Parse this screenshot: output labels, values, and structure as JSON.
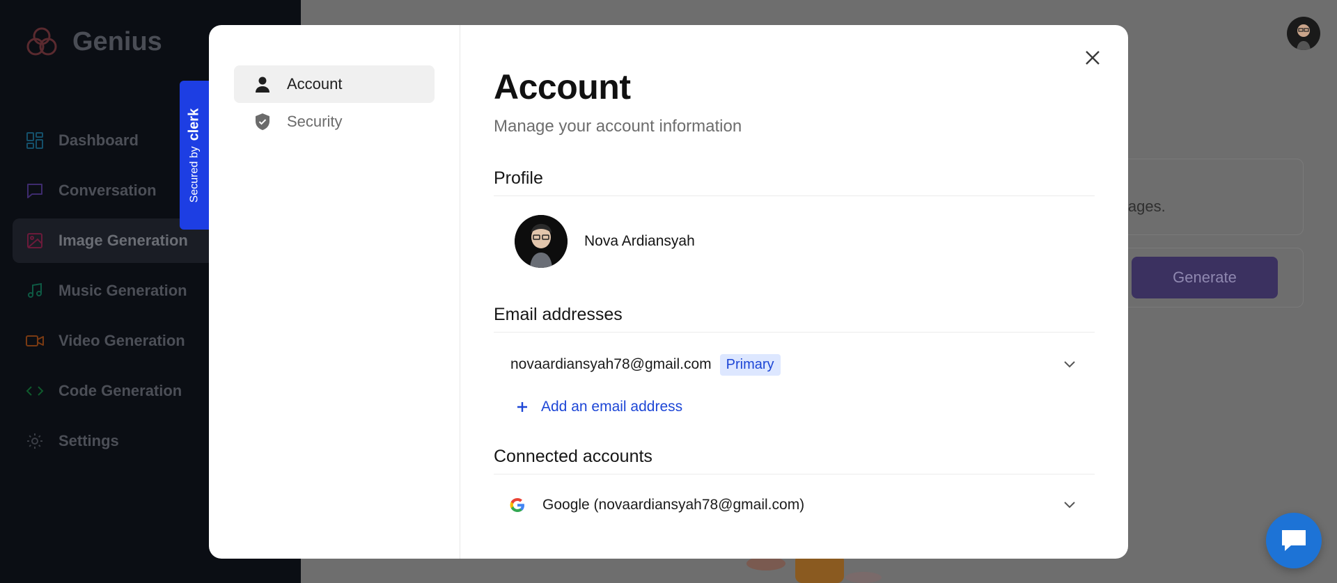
{
  "app": {
    "name": "Genius",
    "nav": [
      {
        "label": "Dashboard",
        "icon": "dashboard-icon",
        "color": "#0ea5e9"
      },
      {
        "label": "Conversation",
        "icon": "message-square-icon",
        "color": "#8b5cf6"
      },
      {
        "label": "Image Generation",
        "icon": "image-icon",
        "color": "#db2777"
      },
      {
        "label": "Music Generation",
        "icon": "music-icon",
        "color": "#10b981"
      },
      {
        "label": "Video Generation",
        "icon": "video-icon",
        "color": "#f97316"
      },
      {
        "label": "Code Generation",
        "icon": "code-icon",
        "color": "#16a34a"
      },
      {
        "label": "Settings",
        "icon": "gear-icon",
        "color": "#6b7280"
      }
    ],
    "active_nav": "Image Generation",
    "hint_text": "ate images.",
    "generate_label": "Generate"
  },
  "clerk": {
    "secured_by": "Secured by",
    "brand": "clerk"
  },
  "modal": {
    "nav": [
      {
        "label": "Account",
        "icon": "user-icon"
      },
      {
        "label": "Security",
        "icon": "shield-icon"
      }
    ],
    "active_nav": "Account",
    "title": "Account",
    "subtitle": "Manage your account information",
    "profile": {
      "section_title": "Profile",
      "name": "Nova Ardiansyah"
    },
    "emails": {
      "section_title": "Email addresses",
      "items": [
        {
          "address": "novaardiansyah78@gmail.com",
          "badge": "Primary"
        }
      ],
      "add_label": "Add an email address"
    },
    "connected": {
      "section_title": "Connected accounts",
      "items": [
        {
          "label": "Google (novaardiansyah78@gmail.com)",
          "icon": "google-icon"
        }
      ]
    }
  },
  "colors": {
    "accent": "#1d46d6",
    "clerk_blue": "#1d3ee3",
    "chat_blue": "#1d73d6",
    "primary_badge_bg": "#dde7ff"
  }
}
